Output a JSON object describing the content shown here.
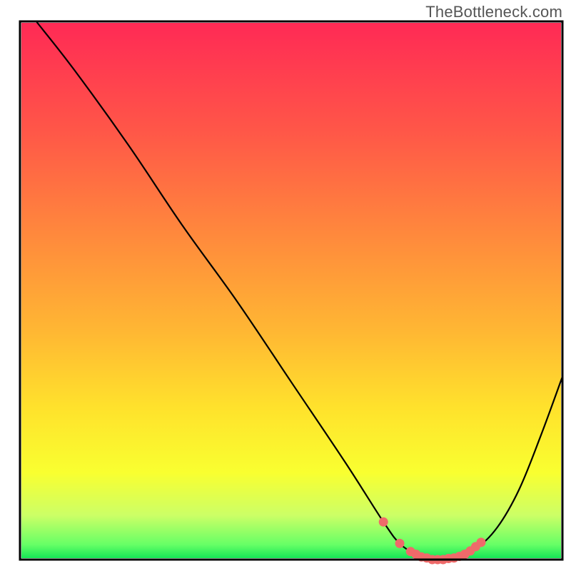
{
  "watermark": "TheBottleneck.com",
  "chart_data": {
    "type": "line",
    "title": "",
    "xlabel": "",
    "ylabel": "",
    "xlim": [
      0,
      100
    ],
    "ylim": [
      0,
      100
    ],
    "grid": false,
    "legend": false,
    "background_gradient": {
      "stops": [
        {
          "offset": 0.0,
          "color": "#ff2a55"
        },
        {
          "offset": 0.2,
          "color": "#ff5648"
        },
        {
          "offset": 0.4,
          "color": "#ff8a3c"
        },
        {
          "offset": 0.58,
          "color": "#ffb833"
        },
        {
          "offset": 0.72,
          "color": "#ffe22c"
        },
        {
          "offset": 0.84,
          "color": "#f9ff30"
        },
        {
          "offset": 0.92,
          "color": "#ccff66"
        },
        {
          "offset": 0.975,
          "color": "#66ff66"
        },
        {
          "offset": 1.0,
          "color": "#16e656"
        }
      ]
    },
    "series": [
      {
        "name": "bottleneck-curve",
        "color": "#000000",
        "x": [
          3,
          10,
          20,
          30,
          40,
          50,
          60,
          67,
          70,
          73,
          76,
          80,
          84,
          88,
          92,
          96,
          100
        ],
        "y": [
          100,
          91,
          77,
          62,
          48,
          33,
          18,
          7,
          3,
          1,
          0,
          0,
          2,
          6,
          13,
          23,
          34
        ]
      },
      {
        "name": "optimal-zone-markers",
        "color": "#ef6a6a",
        "type": "scatter",
        "x": [
          67,
          70,
          72,
          73,
          74,
          75,
          76,
          77,
          78,
          79,
          80,
          81,
          82,
          83,
          84,
          85
        ],
        "y": [
          7,
          3,
          1.5,
          1,
          0.5,
          0.3,
          0,
          0,
          0,
          0.2,
          0.3,
          0.6,
          1,
          1.6,
          2.4,
          3.2
        ]
      }
    ]
  }
}
